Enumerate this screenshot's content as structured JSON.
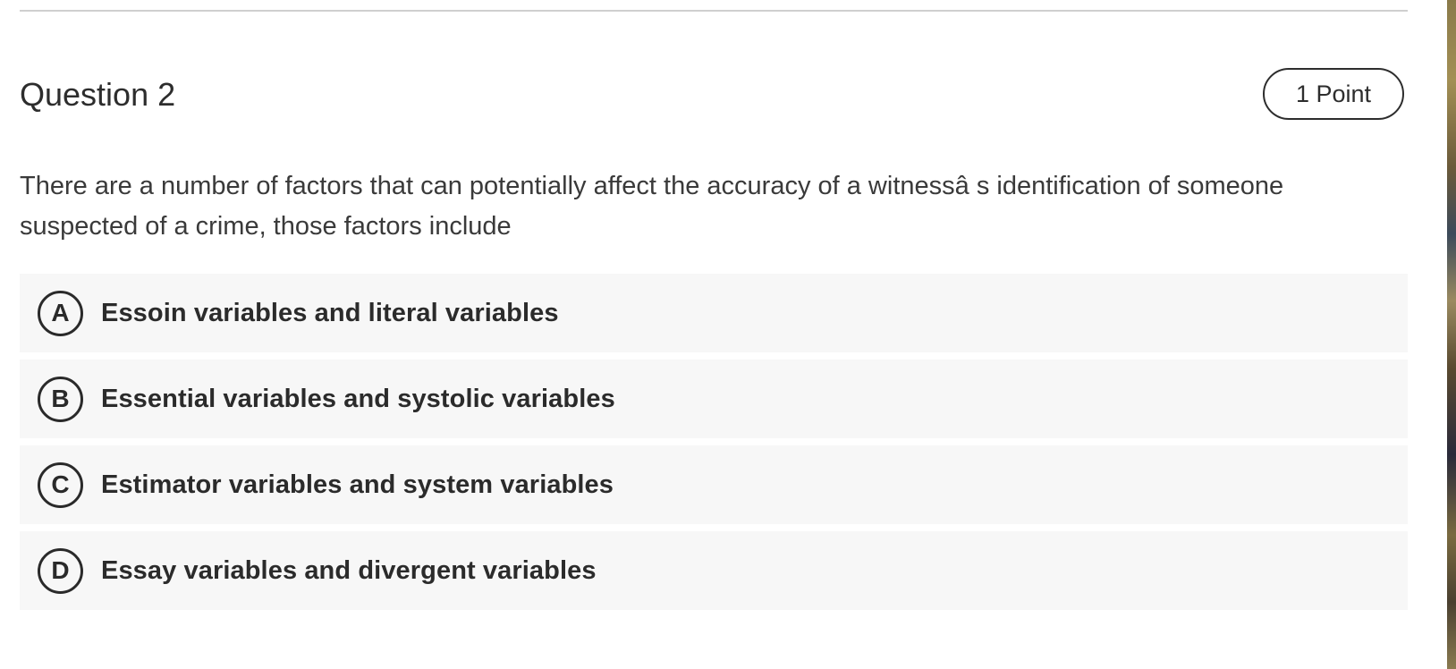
{
  "question": {
    "title": "Question 2",
    "points": "1 Point",
    "text": "There are a number of factors that can potentially affect the accuracy of a witnessâ s identification of someone suspected of a crime, those factors include"
  },
  "options": [
    {
      "letter": "A",
      "label": "Essoin variables and literal variables"
    },
    {
      "letter": "B",
      "label": "Essential variables and systolic variables"
    },
    {
      "letter": "C",
      "label": "Estimator variables and system variables"
    },
    {
      "letter": "D",
      "label": "Essay variables and divergent variables"
    }
  ]
}
